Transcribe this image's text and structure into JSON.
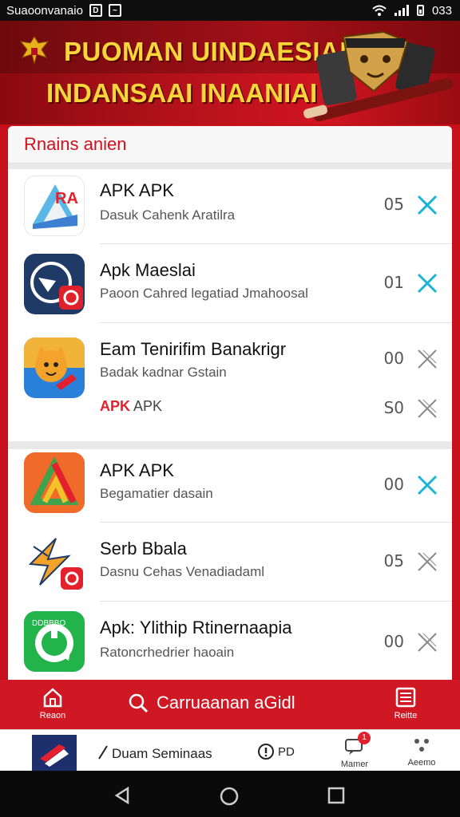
{
  "status_bar": {
    "left_text": "Suaoonvanaio",
    "time": "033"
  },
  "banner": {
    "line1": "PUOMAN UINDAESIAN",
    "line2": "INDANSAAI INAANIAI"
  },
  "section": {
    "title": "Rnains anien"
  },
  "apps": [
    {
      "title": "APK APK",
      "subtitle": "Dasuk Cahenk Aratilra",
      "count": "05",
      "icon": "app-icon-a"
    },
    {
      "title": "Apk Maeslai",
      "subtitle": "Paoon Cahred legatiad Jmahoosal",
      "count": "01",
      "icon": "app-icon-compass"
    },
    {
      "title": "Eam Tenirifim Banakrigr",
      "subtitle": "Badak kadnar Gstain",
      "count": "00",
      "extra_label_red": "APK",
      "extra_label": "APK",
      "extra_count": "S0",
      "icon": "app-icon-dog"
    },
    {
      "title": "APK APK",
      "subtitle": "Begamatier dasain",
      "count": "00",
      "icon": "app-icon-triangle"
    },
    {
      "title": "Serb Bbala",
      "subtitle": "Dasnu Cehas Venadiadaml",
      "count": "05",
      "icon": "app-icon-lightning"
    },
    {
      "title": "Apk: Ylithip Rtinernaapia",
      "subtitle": "Ratoncrhedrier haoain",
      "count": "00",
      "icon": "app-icon-gamepad"
    }
  ],
  "bottom_bar": {
    "home_label": "Reaon",
    "search_text": "Carruaanan aGidl",
    "right_label": "Reitte"
  },
  "tab_bar": {
    "label": "Duam Seminaas",
    "pd_label": "PD",
    "badge": "1",
    "member_label": "Mamer",
    "more_label": "Aeemo"
  },
  "colors": {
    "primary_red": "#d01824",
    "accent_blue": "#1ab5d6",
    "banner_yellow": "#f6d63a"
  }
}
